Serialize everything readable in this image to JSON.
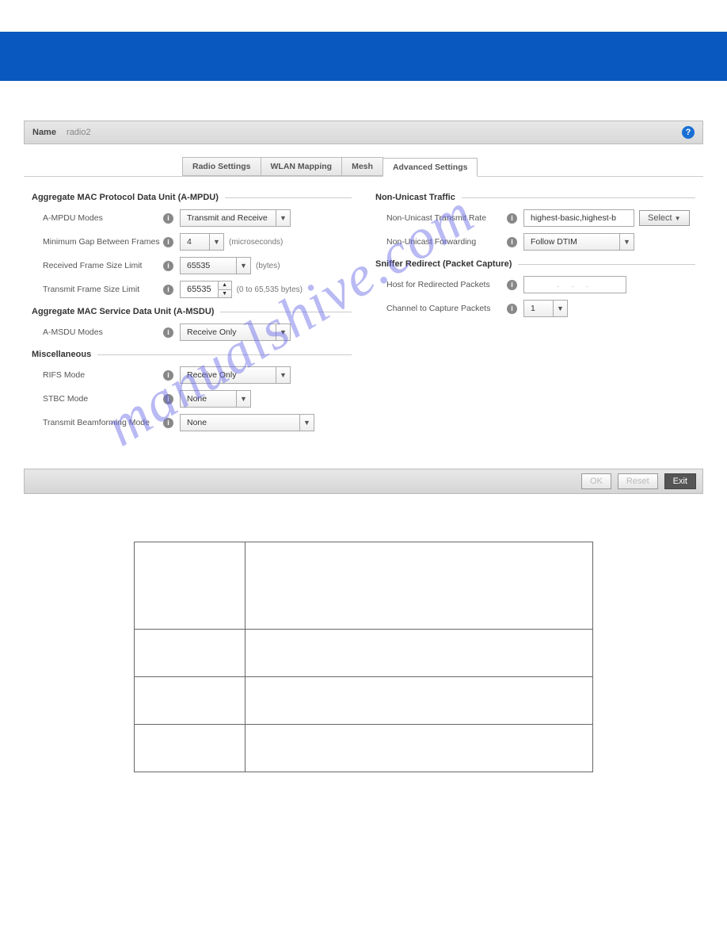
{
  "header": {
    "name_label": "Name",
    "name_value": "radio2",
    "help_char": "?"
  },
  "tabs": {
    "radio": "Radio Settings",
    "wlan": "WLAN Mapping",
    "mesh": "Mesh",
    "advanced": "Advanced Settings"
  },
  "sections": {
    "ampdu": {
      "title": "Aggregate MAC Protocol Data Unit (A-MPDU)",
      "rows": {
        "modes": {
          "label": "A-MPDU Modes",
          "value": "Transmit and Receive"
        },
        "gap": {
          "label": "Minimum Gap Between Frames",
          "value": "4",
          "unit": "(microseconds)"
        },
        "recv": {
          "label": "Received Frame Size Limit",
          "value": "65535",
          "unit": "(bytes)"
        },
        "xmit": {
          "label": "Transmit Frame Size Limit",
          "value": "65535",
          "unit": "(0 to 65,535 bytes)"
        }
      }
    },
    "amsdu": {
      "title": "Aggregate MAC Service Data Unit (A-MSDU)",
      "rows": {
        "modes": {
          "label": "A-MSDU Modes",
          "value": "Receive Only"
        }
      }
    },
    "misc": {
      "title": "Miscellaneous",
      "rows": {
        "rifs": {
          "label": "RIFS Mode",
          "value": "Receive Only"
        },
        "stbc": {
          "label": "STBC Mode",
          "value": "None"
        },
        "beam": {
          "label": "Transmit Beamforming Mode",
          "value": "None"
        }
      }
    },
    "nonuni": {
      "title": "Non-Unicast Traffic",
      "rows": {
        "rate": {
          "label": "Non-Unicast Transmit Rate",
          "value": "highest-basic,highest-b",
          "button": "Select"
        },
        "fwd": {
          "label": "Non-Unicast Forwarding",
          "value": "Follow DTIM"
        }
      }
    },
    "sniffer": {
      "title": "Sniffer Redirect (Packet Capture)",
      "rows": {
        "host": {
          "label": "Host for Redirected Packets",
          "placeholder": ". . ."
        },
        "chan": {
          "label": "Channel to Capture Packets",
          "value": "1"
        }
      }
    }
  },
  "footer": {
    "ok": "OK",
    "reset": "Reset",
    "exit": "Exit"
  },
  "watermark": "manualshive.com"
}
